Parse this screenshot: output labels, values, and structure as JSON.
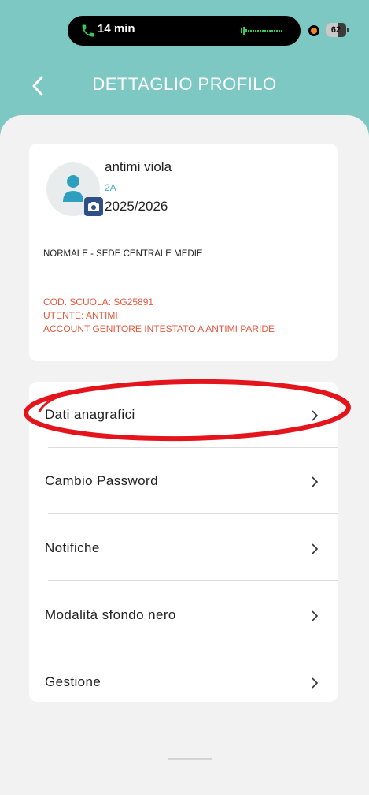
{
  "status_bar": {
    "call_duration": "14 min",
    "battery_level": "62",
    "battery_fraction": 0.62,
    "colors": {
      "call_green": "#34c759",
      "recording_dot": "#f0882a"
    }
  },
  "header": {
    "title": "DETTAGLIO PROFILO",
    "back_icon": "chevron-left-icon"
  },
  "profile": {
    "name": "antimi viola",
    "class": "2A",
    "school_year": "2025/2026",
    "school_type": "NORMALE - SEDE CENTRALE MEDIE",
    "school_code": "COD. SCUOLA: SG25891",
    "user": "UTENTE: ANTIMI",
    "account": "ACCOUNT GENITORE INTESTATO A ANTIMI PARIDE",
    "avatar_icon": "user-icon",
    "camera_icon": "camera-icon"
  },
  "menu": {
    "items": [
      {
        "label": "Dati anagrafici"
      },
      {
        "label": "Cambio Password"
      },
      {
        "label": "Notifiche"
      },
      {
        "label": "Modalità sfondo nero"
      },
      {
        "label": "Gestione"
      }
    ],
    "chevron_icon": "chevron-right-icon"
  },
  "annotation": {
    "highlighted_item": "Dati anagrafici",
    "color": "#e3141b"
  },
  "colors": {
    "header_bg": "#7ec8c4",
    "sheet_bg": "#f2f2f2",
    "accent_red": "#e5583f",
    "class_blue": "#4aaeca",
    "camera_badge": "#2f4f86"
  }
}
